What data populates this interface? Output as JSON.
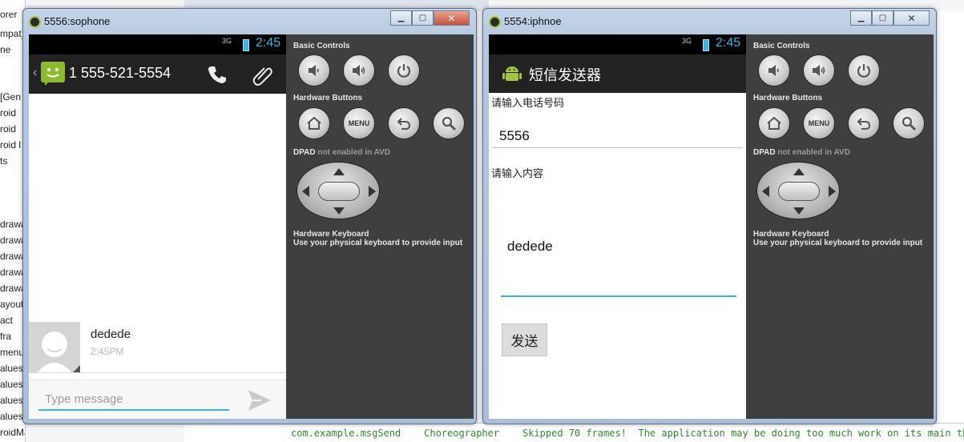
{
  "ide": {
    "tree_items": [
      "orer",
      "mpat_",
      "ne",
      "[Gen",
      "roid",
      "roid",
      "roid l",
      "ts",
      "drawa",
      "drawa",
      "drawa",
      "drawa",
      "drawa",
      "ayout",
      "act",
      "fra",
      "menu",
      "alues",
      "alues",
      "alues",
      "alues",
      "roidManifest.xml"
    ],
    "console_line": "com.example.msgSend    Choreographer    Skipped 70 frames!  The application may be doing too much work on its main th"
  },
  "emulator1": {
    "title": "5556:sophone",
    "status": {
      "network": "3G",
      "time": "2:45"
    },
    "app": {
      "contact_number": "1 555-521-5554",
      "message": {
        "text": "dedede",
        "time": "2:45PM"
      },
      "compose_placeholder": "Type message"
    }
  },
  "emulator2": {
    "title": "5554:iphnoe",
    "status": {
      "network": "3G",
      "time": "2:45"
    },
    "app": {
      "title": "短信发送器",
      "phone_label": "请输入电话号码",
      "phone_value": "5556",
      "content_label": "请输入内容",
      "content_value": "dedede",
      "send_button": "发送"
    }
  },
  "controls": {
    "basic": "Basic Controls",
    "hardware": "Hardware Buttons",
    "dpad": "DPAD",
    "dpad_note": "not enabled in AVD",
    "keyboard": "Hardware Keyboard",
    "keyboard_note": "Use your physical keyboard to provide input",
    "menu_label": "MENU"
  },
  "colors": {
    "holo_blue": "#33b5e5",
    "panel": "#3f3f3f",
    "action_bar": "#222222",
    "android_green": "#a4c639"
  }
}
